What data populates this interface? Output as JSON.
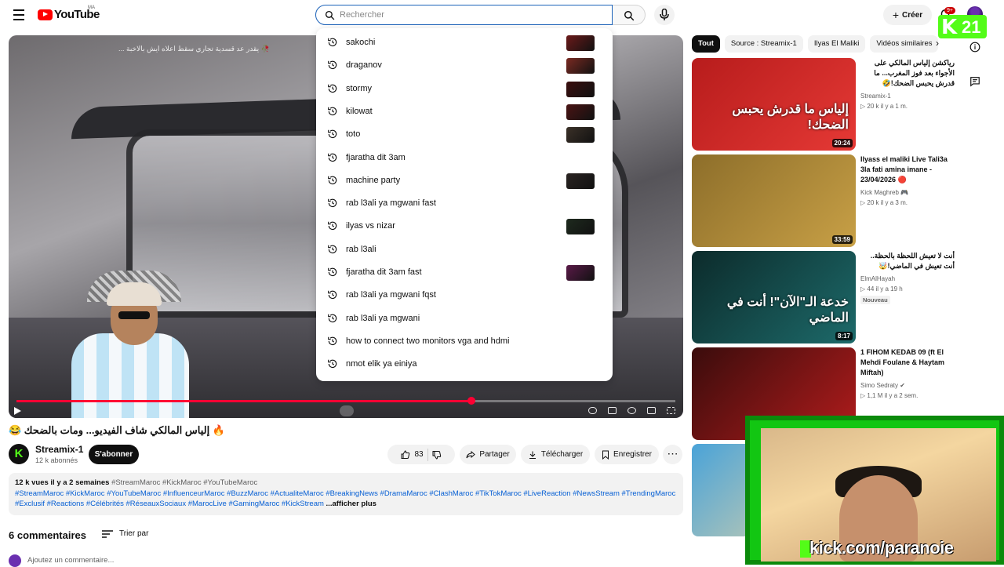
{
  "header": {
    "logo_text": "YouTube",
    "region": "MA",
    "search_placeholder": "Rechercher",
    "create_label": "Créer",
    "notifications_count": "9+"
  },
  "suggestions": [
    {
      "text": "sakochi",
      "thumb": "#6b1a1a"
    },
    {
      "text": "draganov",
      "thumb": "#7a2a22"
    },
    {
      "text": "stormy",
      "thumb": "#3a0e0e"
    },
    {
      "text": "kilowat",
      "thumb": "#4a1414"
    },
    {
      "text": "toto",
      "thumb": "#3b3128"
    },
    {
      "text": "fjaratha dit 3am",
      "thumb": ""
    },
    {
      "text": "machine party",
      "thumb": "#2a2422"
    },
    {
      "text": "rab l3ali ya mgwani fast",
      "thumb": ""
    },
    {
      "text": "ilyas vs nizar",
      "thumb": "#1e2a1e"
    },
    {
      "text": "rab l3ali",
      "thumb": ""
    },
    {
      "text": "fjaratha dit 3am fast",
      "thumb": "#5a1a48"
    },
    {
      "text": "rab l3ali ya mgwani fqst",
      "thumb": ""
    },
    {
      "text": "rab l3ali ya mgwani",
      "thumb": ""
    },
    {
      "text": "how to connect two monitors vga and hdmi",
      "thumb": ""
    },
    {
      "text": "nmot elik ya einiya",
      "thumb": ""
    }
  ],
  "player": {
    "top_caption": "🥀 يقدر عد قسدية تجاري سقط اعلاه ايش بالاخبة ...",
    "progress": 0.69
  },
  "video": {
    "title": "🔥 إلياس المالكي شاف الفيديو... ومات بالضحك 😂",
    "channel_name": "Streamix-1",
    "channel_subs": "12 k abonnés",
    "channel_initial": "K",
    "subscribe_label": "S'abonner",
    "likes": "83",
    "share_label": "Partager",
    "download_label": "Télécharger",
    "save_label": "Enregistrer"
  },
  "description": {
    "stats": "12 k vues  il y a 2 semaines",
    "line1_tags": "#StreamMaroc #KickMaroc #YouTubeMaroc",
    "line2_tags": "#StreamMaroc #KickMaroc #YouTubeMaroc #InfluenceurMaroc #BuzzMaroc #ActualiteMaroc #BreakingNews #DramaMaroc #ClashMaroc #TikTokMaroc #LiveReaction #NewsStream #TrendingMaroc",
    "line3_tags": "#Exclusif #Reactions #Célébrités #RéseauxSociaux #MarocLive #GamingMaroc #KickStream",
    "more": "...afficher plus"
  },
  "comments": {
    "count_label": "6 commentaires",
    "sort_label": "Trier par",
    "add_placeholder": "Ajoutez un commentaire..."
  },
  "chips": [
    "Tout",
    "Source : Streamix-1",
    "Ilyas El Maliki",
    "Vidéos similaires"
  ],
  "recommendations": [
    {
      "title": "رياكشن إلياس المالكي على الأجواء بعد فوز المغرب... ما قدرش يحبس الضحك!🤣",
      "channel": "Streamix-1",
      "meta": "▷ 20 k   il y a 1 m.",
      "duration": "20:24",
      "rtl": true,
      "thumb_text": "إلياس ما قدرش يحبس الضحك!",
      "colors": [
        "#b71c1c",
        "#e53935"
      ]
    },
    {
      "title": "Ilyass el maliki Live Tali3a 3la fati amina imane - 23/04/2026 🔴",
      "channel": "Kick Maghreb 🎮",
      "meta": "▷ 20 k   il y a 3 m.",
      "duration": "33:59",
      "rtl": false,
      "thumb_text": "",
      "colors": [
        "#8d6e2a",
        "#c8a046"
      ]
    },
    {
      "title": "أنت لا تعيش اللحظة بالحظة.. أنت تعيش في الماضي!🤯",
      "channel": "ElmAlHayah",
      "meta": "▷ 44   il y a 19 h",
      "badge": "Nouveau",
      "duration": "8:17",
      "rtl": true,
      "thumb_text": "خدعة الـ\"الآن\"! أنت في الماضي",
      "colors": [
        "#0c2b2b",
        "#1d6a6a"
      ]
    },
    {
      "title": "1 FIHOM KEDAB 09 (ft El Mehdi Foulane & Haytam Miftah)",
      "channel": "Simo Sedraty ✔",
      "meta": "▷ 1,1 M   il y a 2 sem.",
      "duration": "",
      "rtl": false,
      "thumb_text": "",
      "colors": [
        "#3a0c0c",
        "#b21c1c"
      ]
    },
    {
      "title": "",
      "channel": "",
      "meta": "",
      "duration": "",
      "rtl": false,
      "thumb_text": "",
      "colors": [
        "#4aa3d8",
        "#e8d7a6"
      ]
    }
  ],
  "overlay": {
    "kick_count": "21",
    "kick_url": "kick.com/paranoie"
  },
  "colors": {
    "accent_red": "#ff0000",
    "link_blue": "#065fd4",
    "kick_green": "#53fc18"
  }
}
